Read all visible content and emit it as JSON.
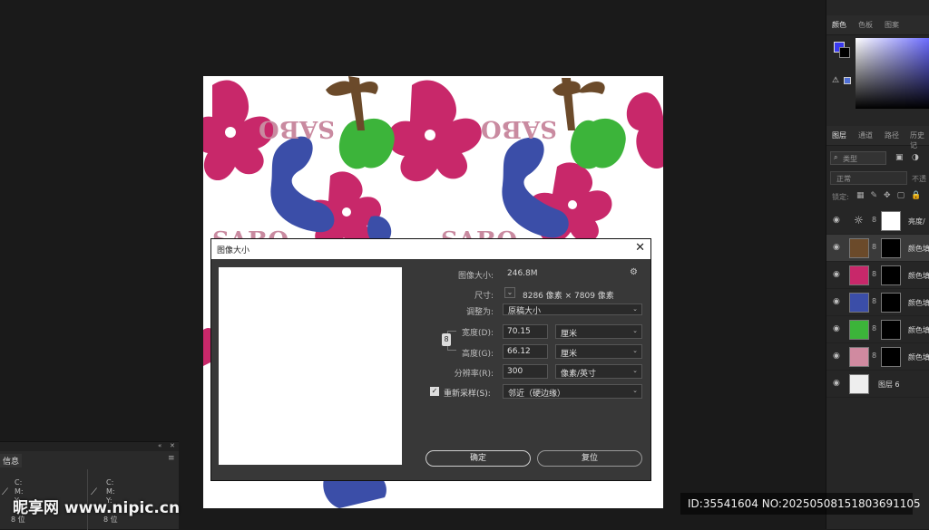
{
  "canvas": {
    "text_repeat": "SABO",
    "colors": {
      "magenta": "#c8286a",
      "blue": "#3b4ea8",
      "green": "#3cb43a",
      "brown": "#6b4a2a",
      "pink_text": "#c98aa0"
    }
  },
  "right_panel": {
    "color_tabs": [
      "颜色",
      "色板",
      "图案"
    ],
    "fg_color": "#3a3af0",
    "bg_color": "#000000",
    "layer_tabs": [
      "图层",
      "通道",
      "路径",
      "历史记"
    ],
    "search_placeholder": "类型",
    "blend_mode": "正常",
    "opacity_label": "不透",
    "lock_label": "锁定:",
    "layers": [
      {
        "name": "亮度/",
        "thumb_color": "#ffffff",
        "type": "adjustment"
      },
      {
        "name": "颜色填",
        "thumb_color": "#6b4a2a",
        "type": "fill"
      },
      {
        "name": "颜色填",
        "thumb_color": "#c8286a",
        "type": "fill"
      },
      {
        "name": "颜色填",
        "thumb_color": "#3b4ea8",
        "type": "fill"
      },
      {
        "name": "颜色填",
        "thumb_color": "#3cb43a",
        "type": "fill"
      },
      {
        "name": "颜色填",
        "thumb_color": "#d08aa0",
        "type": "fill"
      },
      {
        "name": "图层 6",
        "thumb_color": "#eeeeee",
        "type": "pixel"
      }
    ]
  },
  "dialog": {
    "title": "图像大小",
    "image_size_label": "图像大小:",
    "image_size_value": "246.8M",
    "dimensions_label": "尺寸:",
    "dimensions_value": "8286 像素 × 7809 像素",
    "fit_to_label": "调整为:",
    "fit_to_value": "原稿大小",
    "width_label": "宽度(D):",
    "width_value": "70.15",
    "width_unit": "厘米",
    "height_label": "高度(G):",
    "height_value": "66.12",
    "height_unit": "厘米",
    "resolution_label": "分辨率(R):",
    "resolution_value": "300",
    "resolution_unit": "像素/英寸",
    "resample_label": "重新采样(S):",
    "resample_value": "邻近（硬边缘）",
    "ok_label": "确定",
    "reset_label": "复位"
  },
  "info_panel": {
    "title": "信息",
    "channels": [
      "C:",
      "M:",
      "Y:"
    ],
    "bit_label": "8 位"
  },
  "watermark": {
    "site": "昵享网 www.nipic.cn",
    "id_text": "ID:35541604 NO:20250508151803691105"
  }
}
